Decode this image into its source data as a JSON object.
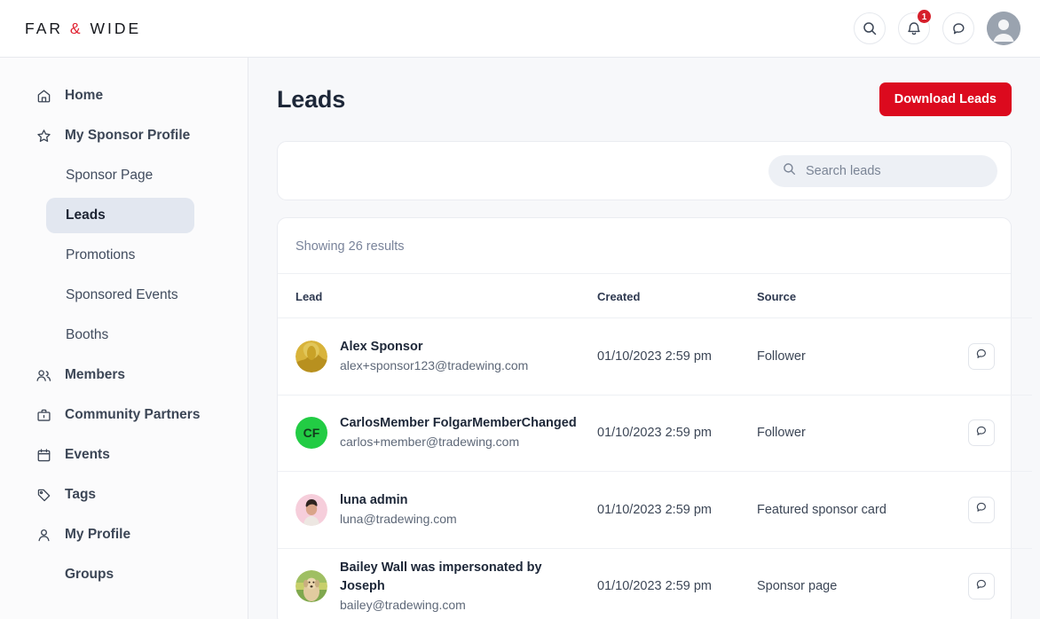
{
  "brand": {
    "part1": "FAR",
    "amp": "&",
    "part2": "WIDE"
  },
  "topbar": {
    "search_icon": "search-icon",
    "bell_icon": "bell-icon",
    "notification_count": "1",
    "chat_icon": "chat-bubble-icon",
    "avatar": "user-avatar"
  },
  "sidebar": {
    "items": [
      {
        "label": "Home",
        "icon": "home-icon"
      },
      {
        "label": "My Sponsor Profile",
        "icon": "star-icon"
      },
      {
        "label": "Members",
        "icon": "members-icon"
      },
      {
        "label": "Community Partners",
        "icon": "briefcase-icon"
      },
      {
        "label": "Events",
        "icon": "calendar-icon"
      },
      {
        "label": "Tags",
        "icon": "tag-icon"
      },
      {
        "label": "My Profile",
        "icon": "person-icon"
      },
      {
        "label": "Groups",
        "icon": "groups-icon"
      }
    ],
    "sub_items": [
      {
        "label": "Sponsor Page",
        "active": false
      },
      {
        "label": "Leads",
        "active": true
      },
      {
        "label": "Promotions",
        "active": false
      },
      {
        "label": "Sponsored Events",
        "active": false
      },
      {
        "label": "Booths",
        "active": false
      }
    ]
  },
  "page": {
    "title": "Leads",
    "download_button": "Download Leads",
    "accent_color": "#DC0A1E"
  },
  "search": {
    "placeholder": "Search leads",
    "value": "",
    "icon": "search-icon"
  },
  "table": {
    "results_text": "Showing 26 results",
    "columns": [
      "Lead",
      "Created",
      "Source"
    ],
    "action_icon": "chat-bubble-icon",
    "rows": [
      {
        "name": "Alex Sponsor",
        "email": "alex+sponsor123@tradewing.com",
        "created": "01/10/2023 2:59 pm",
        "source": "Follower",
        "avatar_type": "photo",
        "avatar_color": "#C9A227"
      },
      {
        "name": "CarlosMember FolgarMemberChanged",
        "email": "carlos+member@tradewing.com",
        "created": "01/10/2023 2:59 pm",
        "source": "Follower",
        "avatar_type": "initials",
        "avatar_initials": "CF",
        "avatar_color": "#22CC44"
      },
      {
        "name": "luna admin",
        "email": "luna@tradewing.com",
        "created": "01/10/2023 2:59 pm",
        "source": "Featured sponsor card",
        "avatar_type": "photo",
        "avatar_color": "#F4C8D6"
      },
      {
        "name": "Bailey Wall was impersonated by Joseph",
        "email": "bailey@tradewing.com",
        "created": "01/10/2023 2:59 pm",
        "source": "Sponsor page",
        "avatar_type": "photo",
        "avatar_color": "#8FAF5A"
      }
    ]
  }
}
